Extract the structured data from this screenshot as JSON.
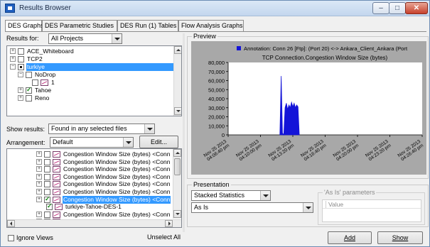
{
  "window": {
    "title": "Results Browser",
    "controls": {
      "minimize": "–",
      "maximize": "□",
      "close": "✕"
    }
  },
  "tabs": [
    {
      "label": "DES Graphs",
      "active": true
    },
    {
      "label": "DES Parametric Studies",
      "active": false
    },
    {
      "label": "DES Run (1) Tables",
      "active": false
    },
    {
      "label": "Flow Analysis Graphs",
      "active": false
    }
  ],
  "results_for": {
    "label": "Results for:",
    "value": "All Projects"
  },
  "project_tree": [
    {
      "label": "ACE_Whiteboard",
      "indent": 0,
      "expander": "+",
      "checkbox": "empty",
      "selected": false
    },
    {
      "label": "TCP2",
      "indent": 0,
      "expander": "+",
      "checkbox": "empty",
      "selected": false
    },
    {
      "label": "turkiye",
      "indent": 0,
      "expander": "−",
      "checkbox": "dot",
      "selected": true
    },
    {
      "label": "NoDrop",
      "indent": 1,
      "expander": "−",
      "checkbox": "empty",
      "selected": false
    },
    {
      "label": "1",
      "indent": 2,
      "expander": "",
      "checkbox": "empty",
      "selected": false
    },
    {
      "label": "Tahoe",
      "indent": 1,
      "expander": "+",
      "checkbox": "checked",
      "selected": false
    },
    {
      "label": "Reno",
      "indent": 1,
      "expander": "+",
      "checkbox": "empty",
      "selected": false
    }
  ],
  "show_results": {
    "label": "Show results:",
    "value": "Found in any selected files"
  },
  "arrangement": {
    "label": "Arrangement:",
    "value": "Default",
    "edit_button": "Edit..."
  },
  "stats_list": [
    {
      "label": "Congestion Window Size (bytes) <Conn",
      "indent": 0,
      "checked": false,
      "selected": false
    },
    {
      "label": "Congestion Window Size (bytes) <Conn",
      "indent": 0,
      "checked": false,
      "selected": false
    },
    {
      "label": "Congestion Window Size (bytes) <Conn",
      "indent": 0,
      "checked": false,
      "selected": false
    },
    {
      "label": "Congestion Window Size (bytes) <Conn",
      "indent": 0,
      "checked": false,
      "selected": false
    },
    {
      "label": "Congestion Window Size (bytes) <Conn",
      "indent": 0,
      "checked": false,
      "selected": false
    },
    {
      "label": "Congestion Window Size (bytes) <Conn",
      "indent": 0,
      "checked": false,
      "selected": false
    },
    {
      "label": "Congestion Window Size (bytes) <Conn",
      "indent": 0,
      "checked": true,
      "selected": true
    },
    {
      "label": "turkiye-Tahoe-DES-1",
      "indent": 1,
      "checked": true,
      "selected": false
    },
    {
      "label": "Congestion Window Size (bytes) <Conn",
      "indent": 0,
      "checked": false,
      "selected": false
    },
    {
      "label": "Congestion Window Size (bytes) <Conn",
      "indent": 0,
      "checked": false,
      "selected": false
    }
  ],
  "ignore_views": {
    "label": "Ignore Views",
    "checked": false
  },
  "unselect_all": "Unselect All",
  "preview": {
    "label": "Preview",
    "legend": "Annotation: Conn 26 [Ftp]: (Port 20) <-> Ankara_Client_Ankara (Port",
    "series_color": "#1414d8",
    "background_color": "#a8a8a8"
  },
  "chart_data": {
    "type": "line",
    "title": "TCP Connection.Congestion Window Size (bytes)",
    "xlabel": "",
    "ylabel": "",
    "ylim": [
      0,
      80000
    ],
    "y_ticks": [
      "0",
      "10,000",
      "20,000",
      "30,000",
      "40,000",
      "50,000",
      "60,000",
      "70,000",
      "80,000"
    ],
    "x_ticks": [
      "Nov 25 2013\n04:06:40 pm",
      "Nov 25 2013\n04:10:00 pm",
      "Nov 25 2013\n04:13:20 pm",
      "Nov 25 2013\n04:16:40 pm",
      "Nov 25 2013\n04:20:00 pm",
      "Nov 25 2013\n04:23:20 pm",
      "Nov 25 2013\n04:26:40 pm"
    ],
    "x_domain": [
      0,
      6
    ],
    "grid": false,
    "legend_position": "top",
    "series": [
      {
        "name": "Annotation: Conn 26 [Ftp]: (Port 20) <-> Ankara_Client_Ankara (Port",
        "x": [
          1.6,
          1.64,
          1.68,
          1.72,
          1.76,
          1.8,
          1.84,
          1.88,
          1.92,
          1.96,
          2.0,
          2.04,
          2.08,
          2.12,
          2.16,
          2.2
        ],
        "y": [
          0,
          65000,
          2000,
          0,
          30000,
          35000,
          28000,
          33000,
          30000,
          36000,
          31000,
          35000,
          30000,
          33000,
          31000,
          0
        ]
      }
    ]
  },
  "presentation": {
    "label": "Presentation",
    "mode": "Stacked Statistics",
    "filter": "As Is",
    "params_label": "'As Is' parameters",
    "params_column": "Value"
  },
  "buttons": {
    "add": "Add",
    "show": "Show"
  }
}
